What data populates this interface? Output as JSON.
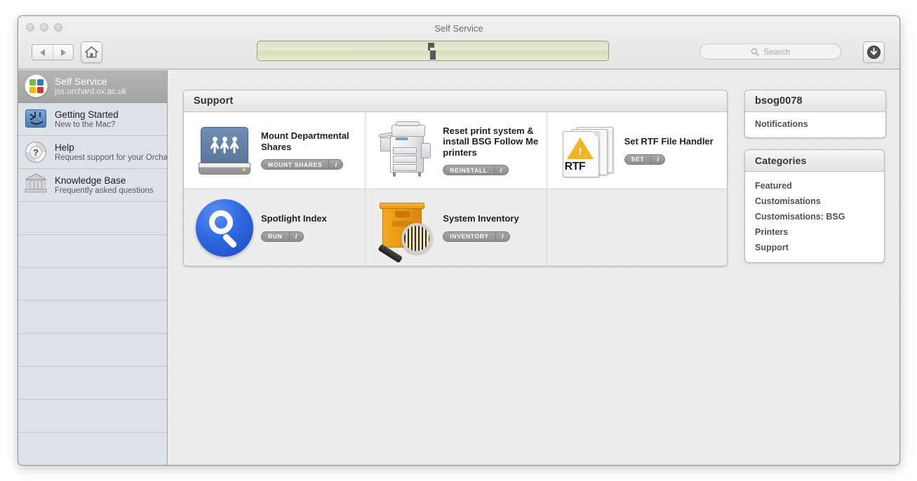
{
  "window": {
    "title": "Self Service"
  },
  "toolbar": {
    "back_label": "Back",
    "forward_label": "Forward",
    "home_label": "Home",
    "search_placeholder": "Search",
    "downloads_label": "Downloads"
  },
  "sidebar": {
    "items": [
      {
        "title": "Self Service",
        "subtitle": "jss.orchard.ox.ac.uk",
        "icon": "self-service-logo-icon",
        "selected": true
      },
      {
        "title": "Getting Started",
        "subtitle": "New to the Mac?",
        "icon": "finder-icon",
        "selected": false
      },
      {
        "title": "Help",
        "subtitle": "Request support for your Orchard",
        "icon": "help-icon",
        "selected": false
      },
      {
        "title": "Knowledge Base",
        "subtitle": "Frequently asked questions",
        "icon": "library-icon",
        "selected": false
      }
    ],
    "empty_row_count": 8
  },
  "main": {
    "section_title": "Support",
    "items": [
      {
        "name": "Mount Departmental Shares",
        "action_label": "MOUNT SHARES",
        "info_label": "i",
        "icon": "network-drive-icon"
      },
      {
        "name": "Reset print system & install BSG Follow Me printers",
        "action_label": "REINSTALL",
        "info_label": "i",
        "icon": "printer-icon"
      },
      {
        "name": "Set RTF File Handler",
        "action_label": "SET",
        "info_label": "i",
        "icon": "rtf-document-icon"
      },
      {
        "name": "Spotlight Index",
        "action_label": "RUN",
        "info_label": "i",
        "icon": "spotlight-icon"
      },
      {
        "name": "System Inventory",
        "action_label": "INVENTORY",
        "info_label": "i",
        "icon": "inventory-box-icon"
      }
    ]
  },
  "user_panel": {
    "username": "bsog0078",
    "items": [
      "Notifications"
    ]
  },
  "categories_panel": {
    "title": "Categories",
    "items": [
      "Featured",
      "Customisations",
      "Customisations: BSG",
      "Printers",
      "Support"
    ]
  },
  "colors": {
    "banner": "#e5e8cb",
    "selected_row": "#ababab",
    "sidebar_bg": "#dde2e9",
    "accent_warning": "#f0b428",
    "spotlight_blue": "#2f68e0",
    "inventory_orange": "#e99410"
  }
}
